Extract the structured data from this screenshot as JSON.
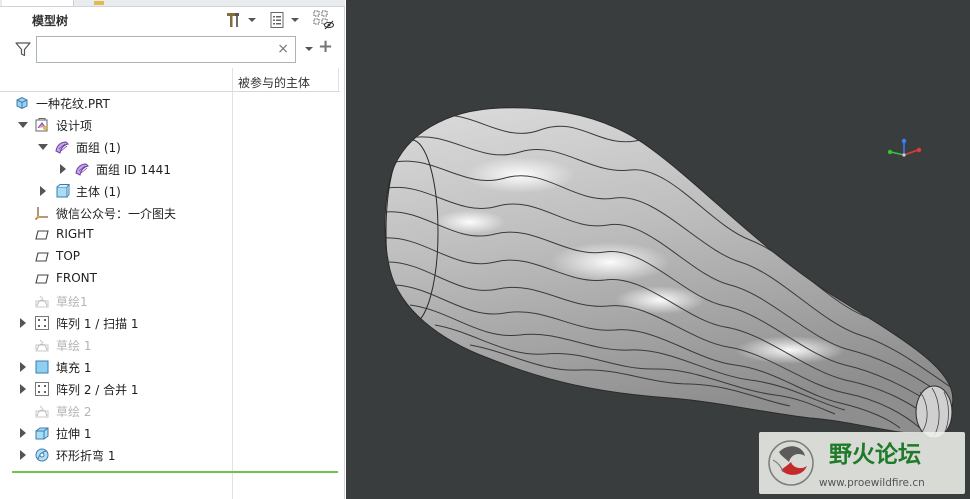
{
  "panel": {
    "title": "模型树",
    "search": {
      "value": "",
      "placeholder": "",
      "clear_glyph": "×",
      "add_glyph": "+"
    },
    "column_header": "被参与的主体"
  },
  "tree": [
    {
      "label": "一种花纹.PRT",
      "icon": "part-icon",
      "toggle": "none",
      "level": 0,
      "dim": false
    },
    {
      "label": "设计项",
      "icon": "design-items-icon",
      "toggle": "expanded",
      "level": 1,
      "dim": false
    },
    {
      "label": "面组 (1)",
      "icon": "quilt-icon",
      "toggle": "expanded",
      "level": 2,
      "dim": false
    },
    {
      "label": "面组 ID 1441",
      "icon": "quilt-icon",
      "toggle": "collapsed",
      "level": 3,
      "dim": false
    },
    {
      "label": "主体 (1)",
      "icon": "body-icon",
      "toggle": "collapsed",
      "level": 2,
      "dim": false
    },
    {
      "label": "微信公众号：一介图夫",
      "icon": "csys-icon",
      "toggle": "none",
      "level": 1,
      "dim": false
    },
    {
      "label": "RIGHT",
      "icon": "datum-plane-icon",
      "toggle": "none",
      "level": 1,
      "dim": false
    },
    {
      "label": "TOP",
      "icon": "datum-plane-icon",
      "toggle": "none",
      "level": 1,
      "dim": false
    },
    {
      "label": "FRONT",
      "icon": "datum-plane-icon",
      "toggle": "none",
      "level": 1,
      "dim": false
    },
    {
      "label": "草绘1",
      "icon": "sketch-icon",
      "toggle": "none",
      "level": 1,
      "dim": true
    },
    {
      "label": "阵列 1 / 扫描 1",
      "icon": "pattern-icon",
      "toggle": "collapsed",
      "level": 1,
      "dim": false
    },
    {
      "label": "草绘 1",
      "icon": "sketch-icon",
      "toggle": "none",
      "level": 1,
      "dim": true
    },
    {
      "label": "填充 1",
      "icon": "fill-icon",
      "toggle": "collapsed",
      "level": 1,
      "dim": false
    },
    {
      "label": "阵列 2 / 合并 1",
      "icon": "pattern-icon",
      "toggle": "collapsed",
      "level": 1,
      "dim": false
    },
    {
      "label": "草绘 2",
      "icon": "sketch-icon",
      "toggle": "none",
      "level": 1,
      "dim": true
    },
    {
      "label": "拉伸 1",
      "icon": "extrude-icon",
      "toggle": "collapsed",
      "level": 1,
      "dim": false
    },
    {
      "label": "环形折弯 1",
      "icon": "toroidal-bend-icon",
      "toggle": "collapsed",
      "level": 1,
      "dim": false
    }
  ],
  "watermark": {
    "title": "野火论坛",
    "url": "www.proewildfire.cn"
  },
  "colors": {
    "viewport_bg": "#3a3d3e",
    "accent_green": "#6fc24b",
    "model_gray": "#c9c9c9",
    "logo_green": "#1f7a2a"
  }
}
